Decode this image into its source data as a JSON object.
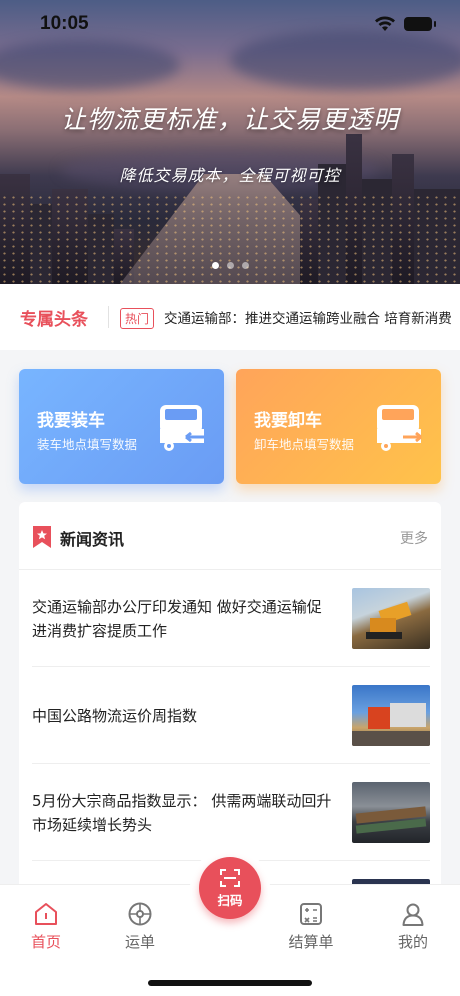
{
  "status_bar": {
    "time": "10:05"
  },
  "banner": {
    "slogan_main": "让物流更标准，让交易更透明",
    "slogan_sub": "降低交易成本，全程可视可控",
    "carousel_count": 3,
    "carousel_active": 1
  },
  "headline": {
    "title": "专属头条",
    "tag": "热门",
    "text": "交通运输部：推进交通运输跨业融合 培育新消费"
  },
  "actions": [
    {
      "title": "我要装车",
      "subtitle": "装车地点填写数据",
      "icon": "truck-load-icon",
      "color": "#6a9cf4"
    },
    {
      "title": "我要卸车",
      "subtitle": "卸车地点填写数据",
      "icon": "truck-unload-icon",
      "color": "#ffa45a"
    }
  ],
  "news": {
    "title": "新闻资讯",
    "more": "更多",
    "items": [
      {
        "text": "交通运输部办公厅印发通知 做好交通运输促进消费扩容提质工作",
        "image": "excavator-photo"
      },
      {
        "text": "中国公路物流运价周指数",
        "image": "truck-photo"
      },
      {
        "text": "5月份大宗商品指数显示： 供需两端联动回升 市场延续增长势头",
        "image": "freight-train-photo"
      }
    ]
  },
  "tabbar": {
    "home": "首页",
    "waybill": "运单",
    "scan": "扫码",
    "settlement": "结算单",
    "mine": "我的"
  },
  "colors": {
    "accent": "#e8505b",
    "blue_card": "#6a9cf4",
    "orange_card": "#ffa45a"
  }
}
